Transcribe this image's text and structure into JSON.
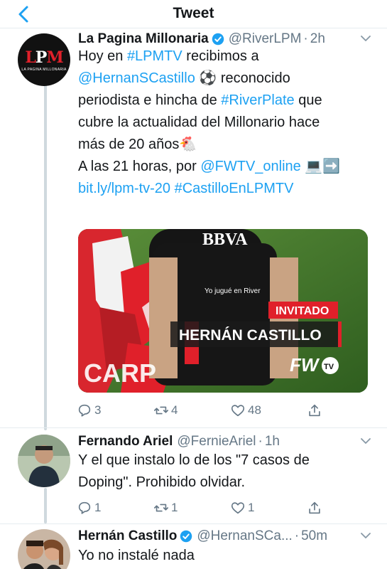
{
  "header": {
    "title": "Tweet"
  },
  "main_tweet": {
    "author_name": "La Pagina Millonaria",
    "author_handle": "@RiverLPM",
    "time": "2h",
    "avatar_text": "LPM",
    "avatar_subtext": "LA PAGINA MILLONARIA",
    "text_lines": [
      [
        {
          "t": "Hoy en ",
          "link": false
        },
        {
          "t": "#LPMTV",
          "link": true
        },
        {
          "t": " recibimos a",
          "link": false
        }
      ],
      [
        {
          "t": "@HernanSCastillo",
          "link": true
        },
        {
          "t": " ⚽ reconocido",
          "link": false
        }
      ],
      [
        {
          "t": "periodista e hincha de ",
          "link": false
        },
        {
          "t": "#RiverPlate",
          "link": true
        },
        {
          "t": " que",
          "link": false
        }
      ],
      [
        {
          "t": "cubre la actualidad del Millonario hace",
          "link": false
        }
      ],
      [
        {
          "t": "más de 20 años🐔",
          "link": false
        }
      ],
      [
        {
          "t": " ",
          "link": false
        }
      ],
      [
        {
          "t": "A las 21 horas, por ",
          "link": false
        },
        {
          "t": "@FWTV_online",
          "link": true
        },
        {
          "t": " 💻➡️",
          "link": false
        }
      ],
      [
        {
          "t": "bit.ly/lpm-tv-20",
          "link": true
        },
        {
          "t": " ",
          "link": false
        },
        {
          "t": "#CastilloEnLPMTV",
          "link": true
        }
      ]
    ],
    "media": {
      "jersey_text": "BBVA",
      "jersey_small_text": "Yo jugué en River",
      "badge_label": "INVITADO",
      "guest_name": "HERNÁN CASTILLO",
      "brand": "FW",
      "brand_suffix": "TV",
      "crest_text": "CARP"
    },
    "replies": "3",
    "retweets": "4",
    "likes": "48"
  },
  "replies": [
    {
      "author_name": "Fernando Ariel",
      "author_handle": "@FernieAriel",
      "time": "1h",
      "text_lines": [
        "Y el que instalo lo de los \"7 casos de",
        "Doping\". Prohibido olvidar."
      ],
      "replies": "1",
      "retweets": "1",
      "likes": "1"
    },
    {
      "author_name": "Hernán Castillo",
      "author_handle": "@HernanSCa...",
      "time": "50m",
      "text_lines": [
        "Yo no instalé nada"
      ]
    }
  ],
  "colors": {
    "accent": "#1da1f2",
    "text": "#14171a",
    "muted": "#657786",
    "line": "#cfd9de",
    "badge_red": "#e0202a"
  },
  "icons": [
    "back-arrow-icon",
    "verified-badge-icon",
    "chevron-down-icon",
    "reply-icon",
    "retweet-icon",
    "like-icon",
    "share-icon"
  ]
}
